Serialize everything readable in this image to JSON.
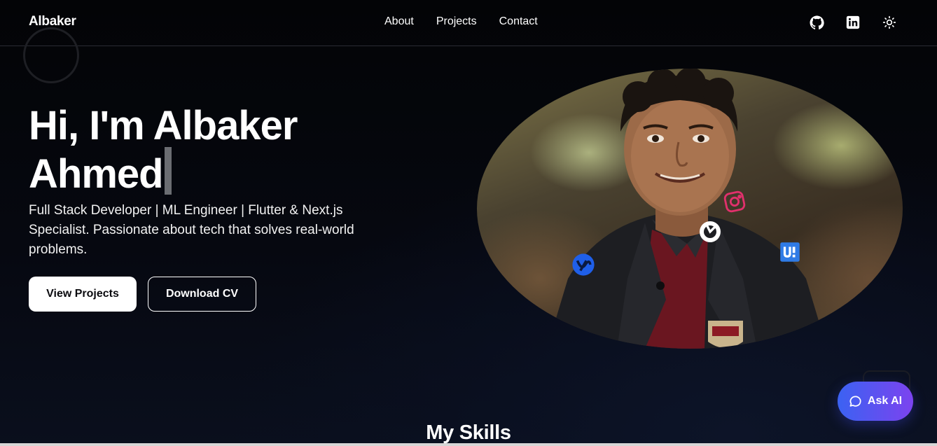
{
  "header": {
    "brand": "Albaker",
    "nav": [
      {
        "label": "About"
      },
      {
        "label": "Projects"
      },
      {
        "label": "Contact"
      }
    ],
    "icons": [
      "github-icon",
      "linkedin-icon",
      "sun-icon"
    ]
  },
  "hero": {
    "title_line1": "Hi, I'm Albaker",
    "title_line2": "Ahmed",
    "subtitle": "Full Stack Developer | ML Engineer | Flutter & Next.js Specialist. Passionate about tech that solves real-world problems.",
    "primary_button": "View Projects",
    "secondary_button": "Download CV"
  },
  "portrait": {
    "floating_icons": [
      "instagram-icon",
      "github-icon",
      "upwork-icon",
      "ui-badge-icon"
    ]
  },
  "skills": {
    "title": "My Skills"
  },
  "ask_ai": {
    "label": "Ask AI",
    "gradient": [
      "#3b62f2",
      "#7c43ef"
    ]
  },
  "colors": {
    "background": "#05060a",
    "text": "#ffffff",
    "instagram": "#e1306c",
    "upwork": "#1f5fe8",
    "badge": "#2f7be6"
  }
}
